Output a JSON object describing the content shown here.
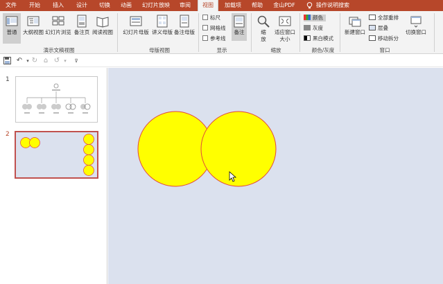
{
  "tabs": [
    "文件",
    "开始",
    "插入",
    "设计",
    "切换",
    "动画",
    "幻灯片放映",
    "审阅",
    "视图",
    "加载项",
    "帮助",
    "金山PDF"
  ],
  "active_tab": "视图",
  "tell_me": "操作说明搜索",
  "ribbon": {
    "views": {
      "normal": "普通",
      "outline": "大纲视图",
      "sorter": "幻灯片浏览",
      "notes_page": "备注页",
      "reading": "阅读视图",
      "group": "演示文稿视图"
    },
    "master": {
      "slide_master": "幻灯片母版",
      "handout_master": "讲义母版",
      "notes_master": "备注母版",
      "group": "母版视图"
    },
    "show": {
      "ruler": "标尺",
      "gridlines": "网格线",
      "guides": "参考线",
      "notes": "备注",
      "group": "显示"
    },
    "zoom": {
      "zoom": "缩放",
      "fit": "适应窗口大小",
      "group": "缩放"
    },
    "color": {
      "color": "颜色",
      "grayscale": "灰度",
      "bw": "黑白模式",
      "group": "颜色/灰度"
    },
    "window": {
      "new_window": "新建窗口",
      "arrange_all": "全部重排",
      "cascade": "层叠",
      "move_split": "移动拆分",
      "switch_windows": "切换窗口",
      "group": "窗口"
    }
  },
  "slides": [
    {
      "number": "1"
    },
    {
      "number": "2"
    }
  ],
  "colors": {
    "accent": "#b7472a",
    "circle_fill": "#ffff00",
    "circle_stroke": "#e0463c",
    "canvas": "#dbe1ee"
  }
}
